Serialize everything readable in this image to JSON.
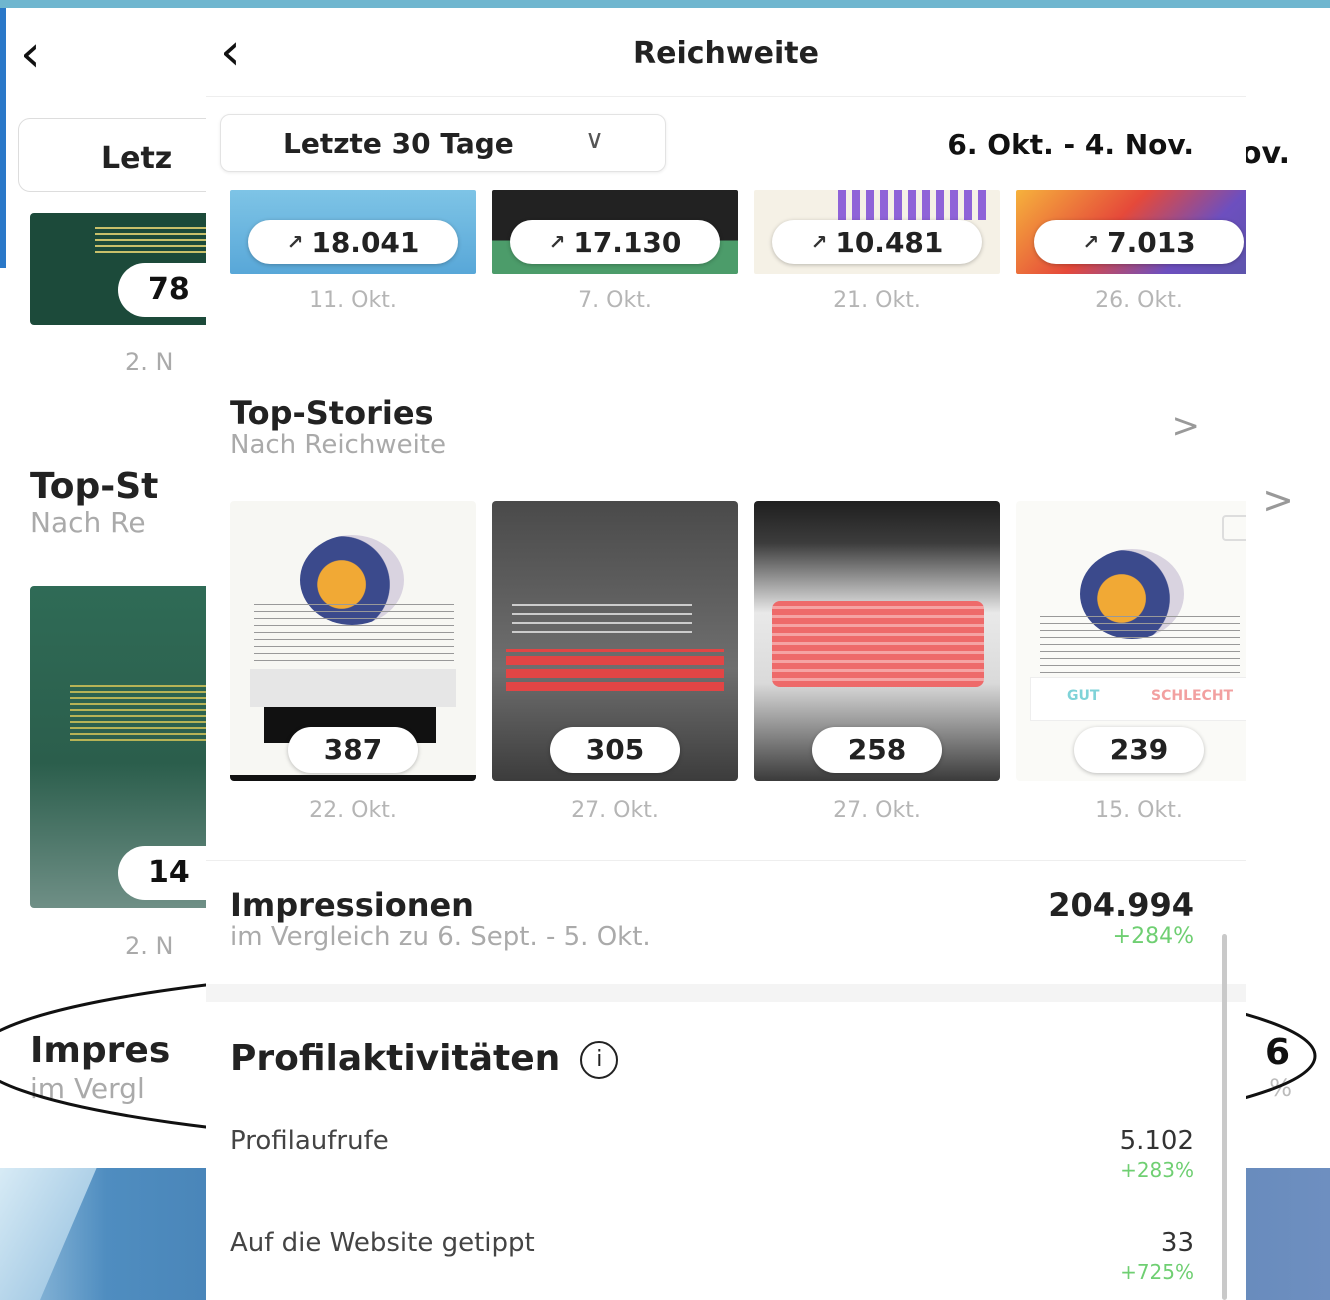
{
  "back_screen": {
    "period_prefix": "Letz",
    "date_suffix": "ov.",
    "post_count": "78",
    "post_date": "2. N",
    "top_stories": "Top-St",
    "by_reach": "Nach Re",
    "story_count": "14",
    "story_date": "2. N",
    "impressions": "Impres",
    "compare": "im Vergl",
    "value": "6",
    "pct": "%"
  },
  "header": {
    "back_icon": "chevron-left-icon",
    "title": "Reichweite"
  },
  "filter": {
    "period": "Letzte 30 Tage",
    "range": "6. Okt. - 4. Nov."
  },
  "top_posts": [
    {
      "value": "18.041",
      "date": "11. Okt."
    },
    {
      "value": "17.130",
      "date": "7. Okt."
    },
    {
      "value": "10.481",
      "date": "21. Okt."
    },
    {
      "value": "7.013",
      "date": "26. Okt."
    }
  ],
  "top_stories": {
    "title": "Top-Stories",
    "subtitle": "Nach Reichweite",
    "items": [
      {
        "value": "387",
        "date": "22. Okt."
      },
      {
        "value": "305",
        "date": "27. Okt."
      },
      {
        "value": "258",
        "date": "27. Okt."
      },
      {
        "value": "239",
        "date": "15. Okt."
      }
    ]
  },
  "impressions": {
    "title": "Impressionen",
    "compare": "im Vergleich zu 6. Sept. - 5. Okt.",
    "value": "204.994",
    "change": "+284%"
  },
  "profile_activity": {
    "title": "Profilaktivitäten",
    "info_icon": "info-icon",
    "rows": [
      {
        "label": "Profilaufrufe",
        "value": "5.102",
        "change": "+283%"
      },
      {
        "label": "Auf die Website getippt",
        "value": "33",
        "change": "+725%"
      }
    ]
  },
  "colors": {
    "positive": "#6fcf72",
    "muted_text": "#aaaaaa"
  }
}
